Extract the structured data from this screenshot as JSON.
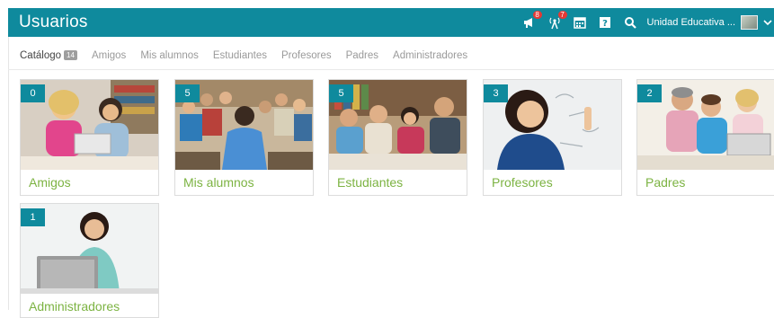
{
  "header": {
    "title": "Usuarios",
    "school": "Unidad Educativa ...",
    "notifications": [
      {
        "icon": "announcement-icon",
        "count": "8"
      },
      {
        "icon": "antenna-icon",
        "count": "7"
      },
      {
        "icon": "calendar-icon"
      },
      {
        "icon": "help-icon"
      },
      {
        "icon": "search-icon"
      }
    ]
  },
  "tabs": {
    "catalogo": "Catálogo",
    "catalogo_count": "14",
    "amigos": "Amigos",
    "mis_alumnos": "Mis alumnos",
    "estudiantes": "Estudiantes",
    "profesores": "Profesores",
    "padres": "Padres",
    "administradores": "Administradores"
  },
  "cards": [
    {
      "label": "Amigos",
      "count": "0"
    },
    {
      "label": "Mis alumnos",
      "count": "5"
    },
    {
      "label": "Estudiantes",
      "count": "5"
    },
    {
      "label": "Profesores",
      "count": "3"
    },
    {
      "label": "Padres",
      "count": "2"
    },
    {
      "label": "Administradores",
      "count": "1"
    }
  ],
  "colors": {
    "accent": "#0f8a9d",
    "label": "#7cb342",
    "alert": "#e53935"
  }
}
